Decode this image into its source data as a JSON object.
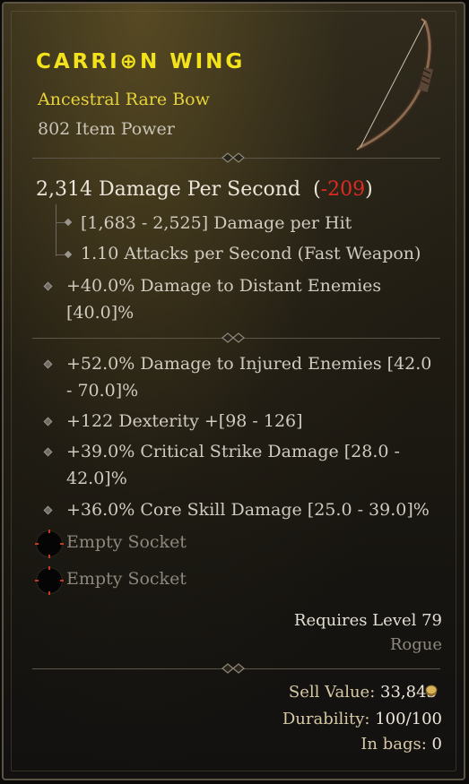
{
  "item": {
    "name": "CARRION WING",
    "type": "Ancestral Rare Bow",
    "item_power": "802 Item Power"
  },
  "damage": {
    "dps": "2,314 Damage Per Second",
    "dps_delta_open": "(",
    "dps_delta": "-209",
    "dps_delta_close": ")",
    "per_hit": "[1,683 - 2,525] Damage per Hit",
    "attack_speed": "1.10 Attacks per Second (Fast Weapon)"
  },
  "implicit": {
    "line1": "+40.0% Damage to Distant Enemies",
    "line2": "[40.0]%"
  },
  "affixes": [
    {
      "line1": "+52.0% Damage to Injured Enemies [42.0",
      "line2": "- 70.0]%"
    },
    {
      "line1": "+122 Dexterity +[98 - 126]",
      "line2": ""
    },
    {
      "line1": "+39.0% Critical Strike Damage [28.0 -",
      "line2": "42.0]%"
    },
    {
      "line1": "+36.0% Core Skill Damage [25.0 - 39.0]%",
      "line2": ""
    }
  ],
  "sockets": [
    "Empty Socket",
    "Empty Socket"
  ],
  "requirements": {
    "level": "Requires Level 79",
    "class": "Rogue"
  },
  "footer": {
    "sell_label": "Sell Value:",
    "sell_value": "33,843",
    "durability_label": "Durability:",
    "durability_value": "100/100",
    "bags_label": "In bags:",
    "bags_value": "0"
  },
  "colors": {
    "title": "#f2e21c",
    "rare": "#e6d23a",
    "negative": "#e02a20",
    "text": "#d0cbc0",
    "muted": "#8d877c"
  },
  "icons": [
    "bow-icon",
    "gold-coin-icon",
    "socket-icon",
    "affix-diamond-icon"
  ]
}
